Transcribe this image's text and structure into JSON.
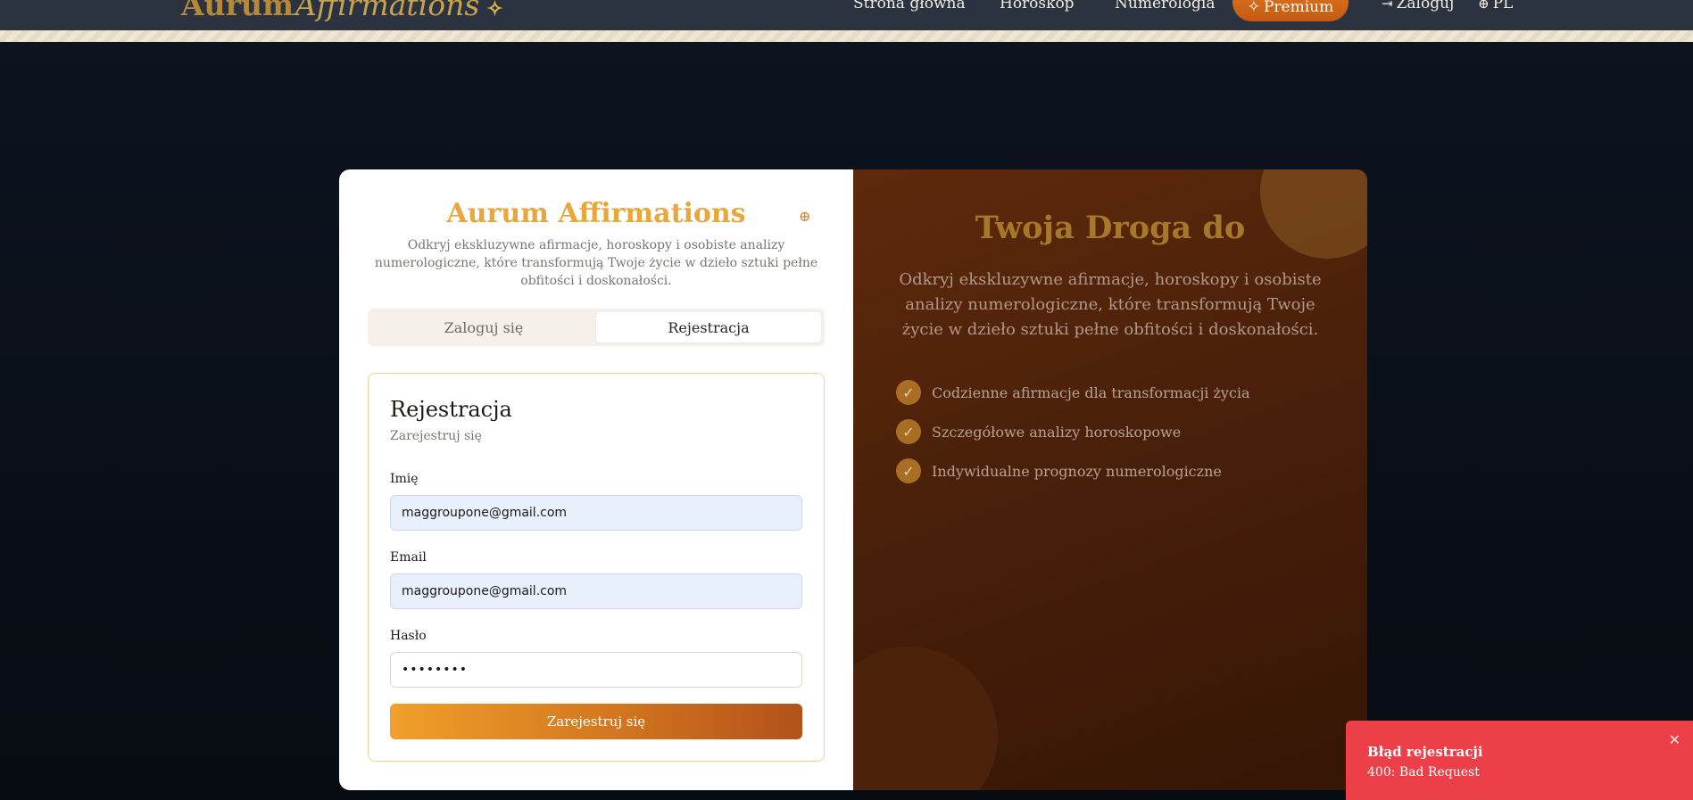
{
  "header": {
    "brand_main": "Aurum",
    "brand_italic": "Affirmations",
    "brand_sparkle_icon": "sparkle-icon",
    "nav": {
      "home": "Strona główna",
      "horoscope": "Horoskop",
      "numerology": "Numerologia",
      "premium": "Premium",
      "login": "Zaloguj",
      "language": "PL"
    }
  },
  "auth": {
    "title": "Aurum Affirmations",
    "subtitle": "Odkryj ekskluzywne afirmacje, horoskopy i osobiste analizy numerologiczne, które transformują Twoje życie w dzieło sztuki pełne obfitości i doskonałości.",
    "tabs": {
      "login": "Zaloguj się",
      "register": "Rejestracja"
    },
    "form": {
      "heading": "Rejestracja",
      "subheading": "Zarejestruj się",
      "name_label": "Imię",
      "name_value": "maggroupone@gmail.com",
      "email_label": "Email",
      "email_value": "maggroupone@gmail.com",
      "password_label": "Hasło",
      "password_value": "••••••••",
      "submit": "Zarejestruj się"
    }
  },
  "promo": {
    "title": "Twoja Droga do",
    "description": "Odkryj ekskluzywne afirmacje, horoskopy i osobiste analizy numerologiczne, które transformują Twoje życie w dzieło sztuki pełne obfitości i doskonałości.",
    "features": [
      "Codzienne afirmacje dla transformacji życia",
      "Szczegółowe analizy horoskopowe",
      "Indywidualne prognozy numerologiczne"
    ]
  },
  "toast": {
    "title": "Błąd rejestracji",
    "message": "400: Bad Request"
  },
  "colors": {
    "accent": "#e9a63b",
    "premium": "#d96a1a",
    "error": "#ec3f48"
  }
}
